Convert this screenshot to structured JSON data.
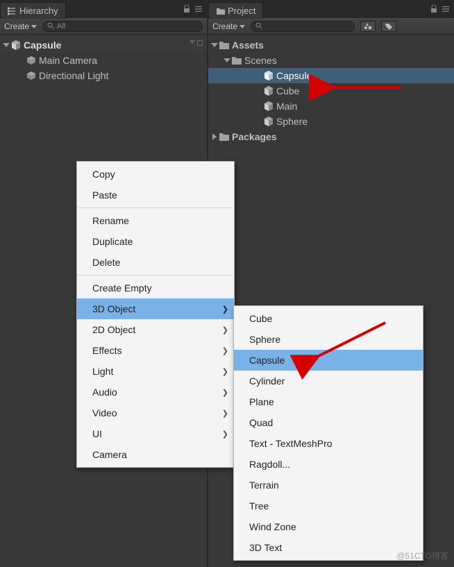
{
  "hierarchy": {
    "tab_label": "Hierarchy",
    "create_label": "Create",
    "search_text": "All",
    "root_object": "Capsule",
    "children": [
      {
        "name": "Main Camera"
      },
      {
        "name": "Directional Light"
      }
    ]
  },
  "project": {
    "tab_label": "Project",
    "create_label": "Create",
    "root": "Assets",
    "scenes_folder": "Scenes",
    "scene_assets": [
      {
        "name": "Capsule",
        "selected": true
      },
      {
        "name": "Cube",
        "selected": false
      },
      {
        "name": "Main",
        "selected": false
      },
      {
        "name": "Sphere",
        "selected": false
      }
    ],
    "packages_folder": "Packages"
  },
  "context_menu": {
    "items": [
      {
        "label": "Copy",
        "submenu": false
      },
      {
        "label": "Paste",
        "submenu": false
      },
      {
        "sep": true
      },
      {
        "label": "Rename",
        "submenu": false
      },
      {
        "label": "Duplicate",
        "submenu": false
      },
      {
        "label": "Delete",
        "submenu": false
      },
      {
        "sep": true
      },
      {
        "label": "Create Empty",
        "submenu": false
      },
      {
        "label": "3D Object",
        "submenu": true,
        "highlighted": true
      },
      {
        "label": "2D Object",
        "submenu": true
      },
      {
        "label": "Effects",
        "submenu": true
      },
      {
        "label": "Light",
        "submenu": true
      },
      {
        "label": "Audio",
        "submenu": true
      },
      {
        "label": "Video",
        "submenu": true
      },
      {
        "label": "UI",
        "submenu": true
      },
      {
        "label": "Camera",
        "submenu": false
      }
    ],
    "submenu_3d": [
      {
        "label": "Cube"
      },
      {
        "label": "Sphere"
      },
      {
        "label": "Capsule",
        "highlighted": true
      },
      {
        "label": "Cylinder"
      },
      {
        "label": "Plane"
      },
      {
        "label": "Quad"
      },
      {
        "label": "Text - TextMeshPro"
      },
      {
        "label": "Ragdoll..."
      },
      {
        "label": "Terrain"
      },
      {
        "label": "Tree"
      },
      {
        "label": "Wind Zone"
      },
      {
        "label": "3D Text"
      }
    ]
  },
  "watermark": "@51CTO博客"
}
